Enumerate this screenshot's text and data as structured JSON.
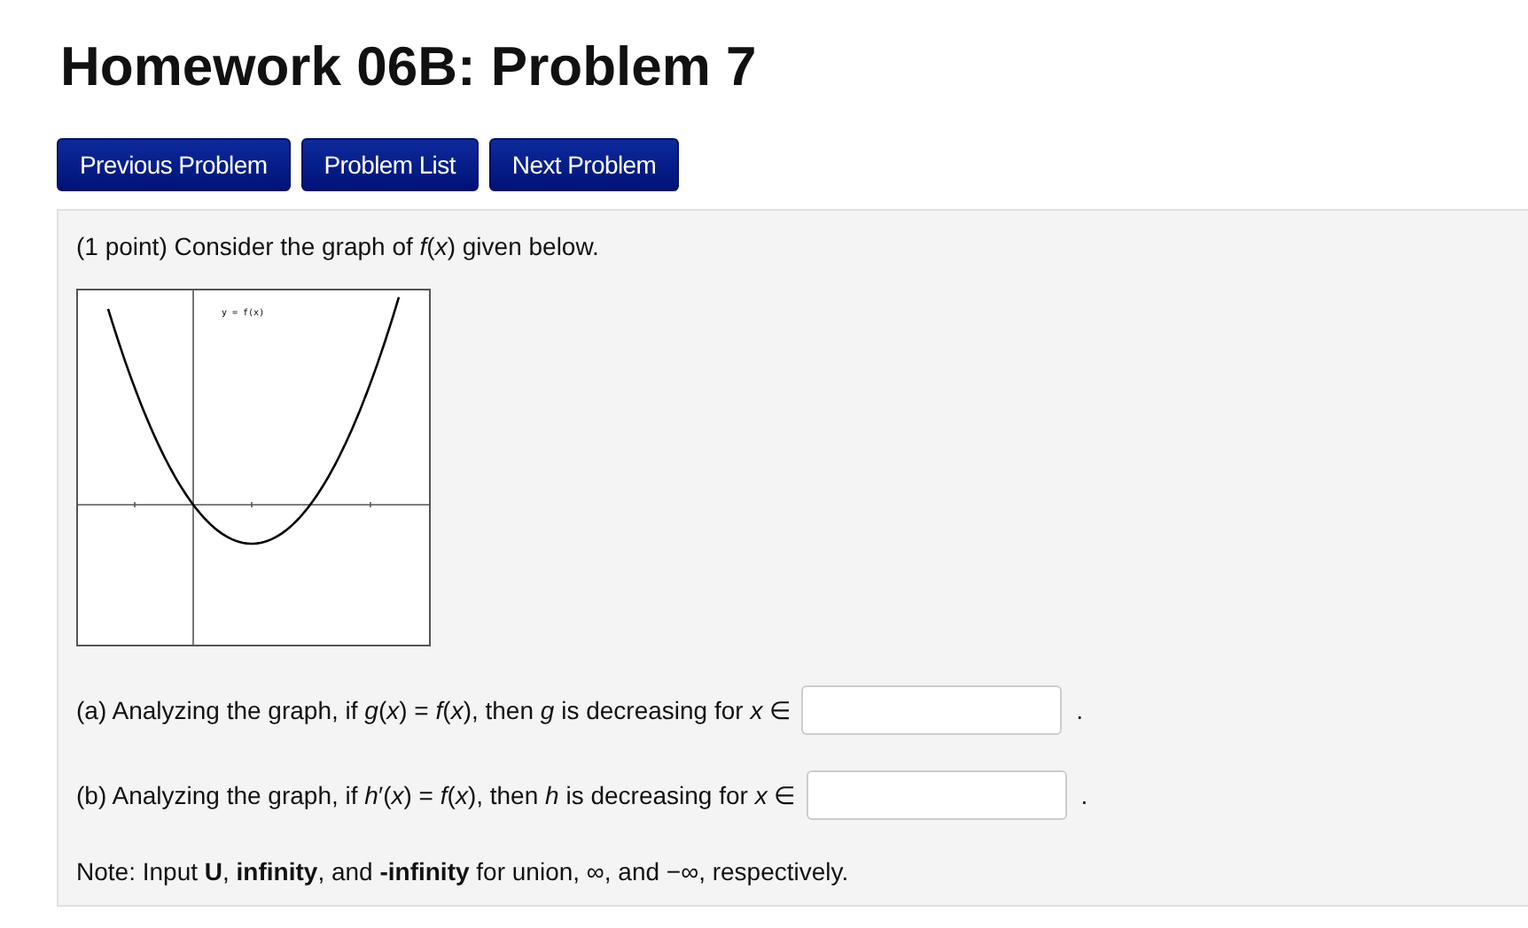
{
  "title": "Homework 06B: Problem 7",
  "nav_buttons": [
    "Previous Problem",
    "Problem List",
    "Next Problem"
  ],
  "problem": {
    "intro": "(1 point) Consider the graph of *f*(*x*) given below.",
    "graph": {
      "label": "y = f(x)"
    },
    "parts": [
      {
        "prompt": "(a) Analyzing the graph, if *g*(*x*) = *f*(*x*), then *g* is decreasing for *x* ∈",
        "after": "."
      },
      {
        "prompt": "(b) Analyzing the graph, if *h*′(*x*) = *f*(*x*), then *h* is decreasing for *x* ∈",
        "after": "."
      }
    ],
    "note": "Note: Input **U**, **infinity**, and **-infinity** for union, ∞, and −∞, respectively."
  }
}
